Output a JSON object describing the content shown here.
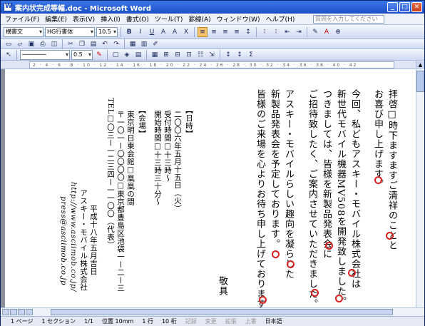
{
  "window": {
    "title": "案内状完成等幅.doc - Microsoft Word"
  },
  "menu": [
    "ファイル(F)",
    "編集(E)",
    "表示(V)",
    "挿入(I)",
    "書式(O)",
    "ツール(T)",
    "罫線(A)",
    "ウィンドウ(W)",
    "ヘルプ(H)"
  ],
  "help_placeholder": "質問を入力してください",
  "format_toolbar": {
    "style": "横書文",
    "font": "HG行書体",
    "size": "10.5"
  },
  "draw_toolbar": {
    "line_weight": "0.5"
  },
  "ruler_ticks": "2 · 4 · 6 · 8 · 10 · 12 · 14 · 16 · 18 · 20 · 22 · 24 · 26 · 28 · 30 · 32 · 34 · 36 · 38 · 40 · 42",
  "document": {
    "lines": [
      "拝啓□時下ますますご清祥のことと",
      "お喜び申し上げます。",
      "今回、私どもアスキー・モバイル株式会社は",
      "新世代モバイル機器MV508を開発致しました。",
      "つきましては、皆様を新製品発表会に",
      "ご招待致したく、ご案内させていただきました。",
      "アスキー・モバイルらしい趣向を凝らした",
      "新製品発表会を予定しております。",
      "皆様のご来場を心よりお待ち申し上げております。",
      "敬具"
    ],
    "details": [
      "【日時】",
      "二〇〇六年五月十五日（火）",
      "受付時間□十三時〜",
      "開始時間□十三時三十分〜",
      "【会場】",
      "東京明日東会館□凰凰の間",
      "〒一〇一ー〇〇〇〇□東京都豊島区池袋一ー二ー三",
      "TEL□〇三ー一二三四ー一一〇〇（代表）"
    ],
    "sender": [
      "平成十八年五月吉日",
      "アスキー・モバイル株式会社",
      "http://www.asciimob.co.jp/",
      "press@asciimob.co.jp"
    ]
  },
  "status": {
    "page": "1 ページ",
    "section": "1 セクション",
    "pages": "1/1",
    "pos": "位置 10mm",
    "line": "1 行",
    "colnum": "10 桁",
    "rec": "記録",
    "trk": "変更",
    "ext": "拡張",
    "ovr": "上書",
    "lang": "日本語"
  },
  "colors": {
    "mark": "#d8201f",
    "titlebar": "#1d4fc4"
  }
}
